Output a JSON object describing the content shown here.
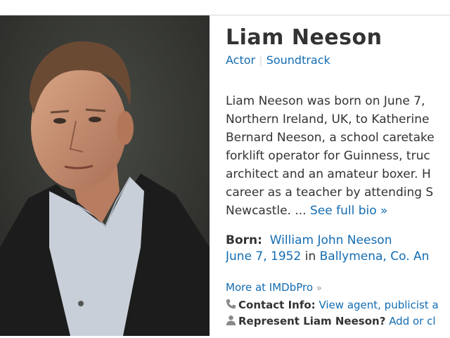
{
  "person": {
    "name": "Liam Neeson",
    "job_actor": "Actor",
    "job_separator": "|",
    "job_soundtrack": "Soundtrack"
  },
  "bio": {
    "line1": "Liam Neeson was born on June 7,",
    "line2": "Northern Ireland, UK, to Katherine",
    "line3": "Bernard Neeson, a school caretake",
    "line4": "forklift operator for Guinness, truc",
    "line5": "architect and an amateur boxer. H",
    "line6": "career as a teacher by attending S",
    "line7_text": "Newcastle. ... ",
    "see_full_bio": "See full bio »"
  },
  "born": {
    "label": "Born:",
    "birth_name": "William John Neeson",
    "birth_date": "June 7, 1952",
    "in_word": "in",
    "place": "Ballymena, Co. An"
  },
  "more": {
    "label": "More at IMDbPro",
    "chevron": "»"
  },
  "contact": {
    "icon": "phone-icon",
    "label": "Contact Info:",
    "link": "View agent, publicist a"
  },
  "represent": {
    "icon": "person-icon",
    "label": "Represent Liam Neeson?",
    "link": "Add or cl"
  }
}
